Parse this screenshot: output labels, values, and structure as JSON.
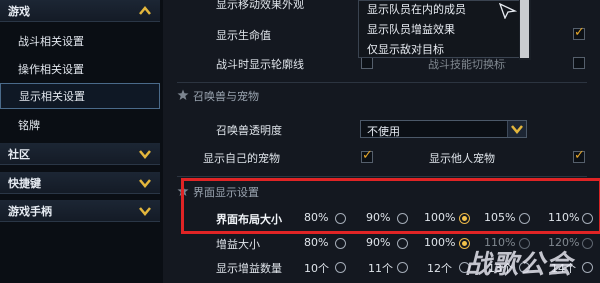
{
  "sidebar": {
    "categories": [
      {
        "label": "游戏"
      },
      {
        "label": "社区"
      },
      {
        "label": "快捷键"
      },
      {
        "label": "游戏手柄"
      }
    ],
    "game_items": [
      "战斗相关设置",
      "操作相关设置",
      "显示相关设置",
      "铭牌"
    ]
  },
  "main": {
    "rows_top": [
      {
        "label": "显示移动效果外观"
      },
      {
        "label": "显示生命值"
      },
      {
        "label": "战斗时显示轮廓线"
      }
    ],
    "popup_options": [
      "显示队员在内的成员",
      "显示队员增益效果",
      "仅显示敌对目标"
    ],
    "truncated_right_text": "战斗技能切换标记",
    "summon_section": {
      "title": "召唤兽与宠物",
      "transparency_label": "召唤兽透明度",
      "transparency_value": "不使用",
      "show_own_pet": "显示自己的宠物",
      "show_other_pet": "显示他人宠物"
    },
    "ui_section": {
      "title": "界面显示设置",
      "layout_size_label": "界面布局大小",
      "layout_options": [
        "80%",
        "90%",
        "100%",
        "105%",
        "110%"
      ],
      "layout_selected": "100%",
      "buff_size_label": "增益大小",
      "buff_options": [
        "80%",
        "90%",
        "100%",
        "110%",
        "120%"
      ],
      "buff_selected": "100%",
      "buff_count_label": "显示增益数量",
      "buff_count_options": [
        "10个",
        "11个",
        "12个",
        "13个",
        "14个"
      ]
    }
  },
  "watermark": "战歌公会",
  "colors": {
    "highlight": "#e02425",
    "accent": "#f4c24a"
  }
}
